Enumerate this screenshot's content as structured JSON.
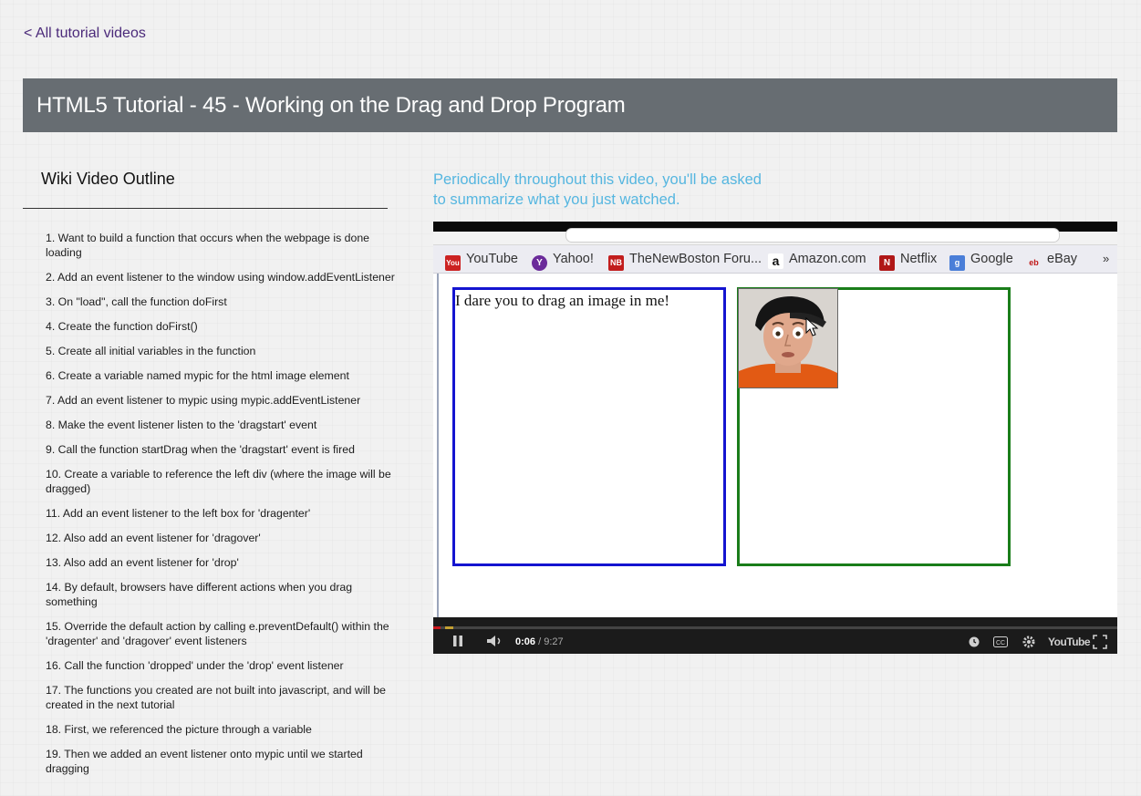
{
  "nav": {
    "back_label": "< All tutorial videos"
  },
  "page_title": "HTML5 Tutorial - 45 - Working on the Drag and Drop Program",
  "outline": {
    "heading": "Wiki Video Outline",
    "items": [
      "1. Want to build a function that occurs when the webpage is done loading",
      "2. Add an event listener to the window using window.addEventListener",
      "3. On \"load\", call the function doFirst",
      "4. Create the function doFirst()",
      "5. Create all initial variables in the function",
      "6. Create a variable named mypic for the html image element",
      "7. Add an event listener to mypic using mypic.addEventListener",
      "8. Make the event listener listen to the 'dragstart' event",
      "9. Call the function startDrag when the 'dragstart' event is fired",
      "10. Create a variable to reference the left div (where the image will be dragged)",
      "11. Add an event listener to the left box for 'dragenter'",
      "12. Also add an event listener for 'dragover'",
      "13. Also add an event listener for 'drop'",
      "14. By default, browsers have different actions when you drag something",
      "15. Override the default action by calling e.preventDefault() within the 'dragenter' and 'dragover' event listeners",
      "16. Call the function 'dropped' under the 'drop' event listener",
      "17. The functions you created are not built into javascript, and will be created in the next tutorial",
      "18. First, we referenced the picture through a variable",
      "19. Then we added an event listener onto mypic until we started dragging"
    ]
  },
  "prompt": {
    "line1": "Periodically throughout this video, you'll be asked",
    "line2": "to summarize what you just watched."
  },
  "video": {
    "bookmarks": {
      "youtube": "YouTube",
      "yahoo": "Yahoo!",
      "thenewboston": "TheNewBoston Foru...",
      "amazon": "Amazon.com",
      "netflix": "Netflix",
      "google": "Google",
      "ebay": "eBay",
      "more": "»"
    },
    "drop_box_text": "I dare you to drag an image in me!",
    "current_time": "0:06",
    "duration": "/ 9:27",
    "progress_fraction": 0.011,
    "youtube_logo": "YouTube",
    "colors": {
      "left_box": "#1414d0",
      "right_box": "#1a7d1a",
      "progress": "#cc181e"
    }
  }
}
